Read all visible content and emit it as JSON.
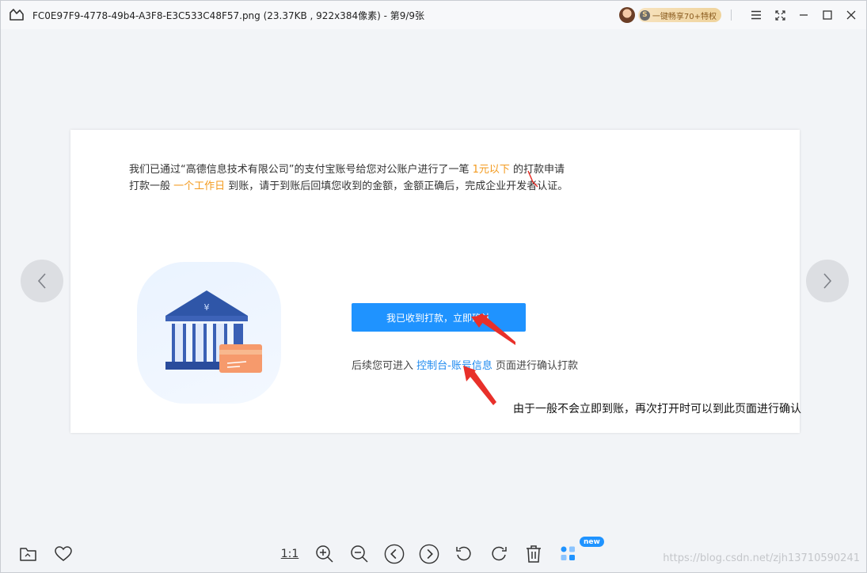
{
  "titlebar": {
    "title": "FC0E97F9-4778-49b4-A3F8-E3C533C48F57.png (23.37KB , 922x384像素) - 第9/9张",
    "vip_label": "一键畅享70+特权",
    "vip_coin": "S"
  },
  "card": {
    "line1_a": "我们已通过“高德信息技术有限公司”的支付宝账号给您对公账户进行了一笔 ",
    "line1_hl": "1元以下",
    "line1_b": "  的打款申请",
    "line2_a": "打款一般 ",
    "line2_hl": "一个工作日",
    "line2_b": " 到账，请于到账后回填您收到的金额，金额正确后，完成企业开发者认证。",
    "bank_symbol": "¥",
    "confirm_button": "我已收到打款，立即确认",
    "follow_prefix": "后续您可进入 ",
    "follow_link": "控制台-账号信息",
    "follow_suffix": " 页面进行确认打款"
  },
  "annotation": "由于一般不会立即到账，再次打开时可以到此页面进行确认",
  "toolbar": {
    "ratio_label": "1:1",
    "new_badge": "new"
  },
  "watermark": "https://blog.csdn.net/zjh13710590241",
  "colors": {
    "accent": "#1f93ff",
    "highlight": "#f39a1e",
    "annotation_arrow": "#e8302a"
  }
}
